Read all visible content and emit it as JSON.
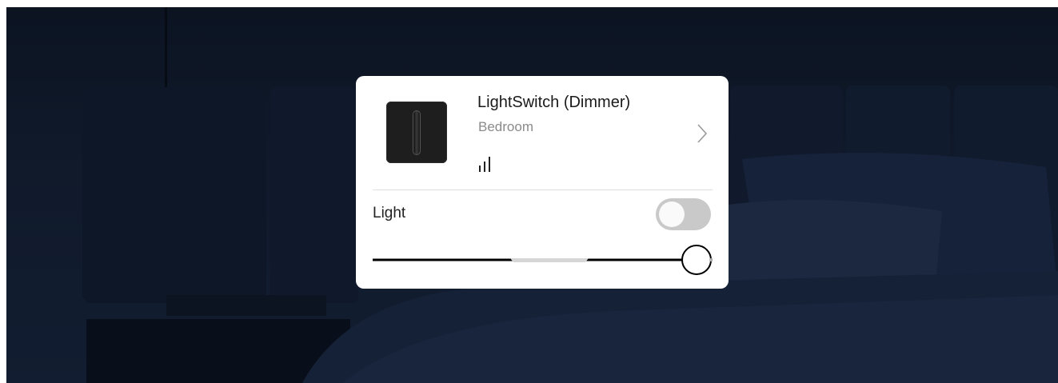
{
  "device": {
    "name": "LightSwitch (Dimmer)",
    "room": "Bedroom",
    "thumbnail_icon": "light-switch-device-icon",
    "signal_icon": "signal-strength-icon",
    "details_icon": "chevron-right-icon"
  },
  "control": {
    "label": "Light",
    "toggle_on": false,
    "brightness_fraction": 0.96
  },
  "colors": {
    "card": "#ffffff",
    "toggle_off": "#c9c9c9",
    "slider_track": "#000000",
    "slider_highlight": "#d6d6d6"
  }
}
